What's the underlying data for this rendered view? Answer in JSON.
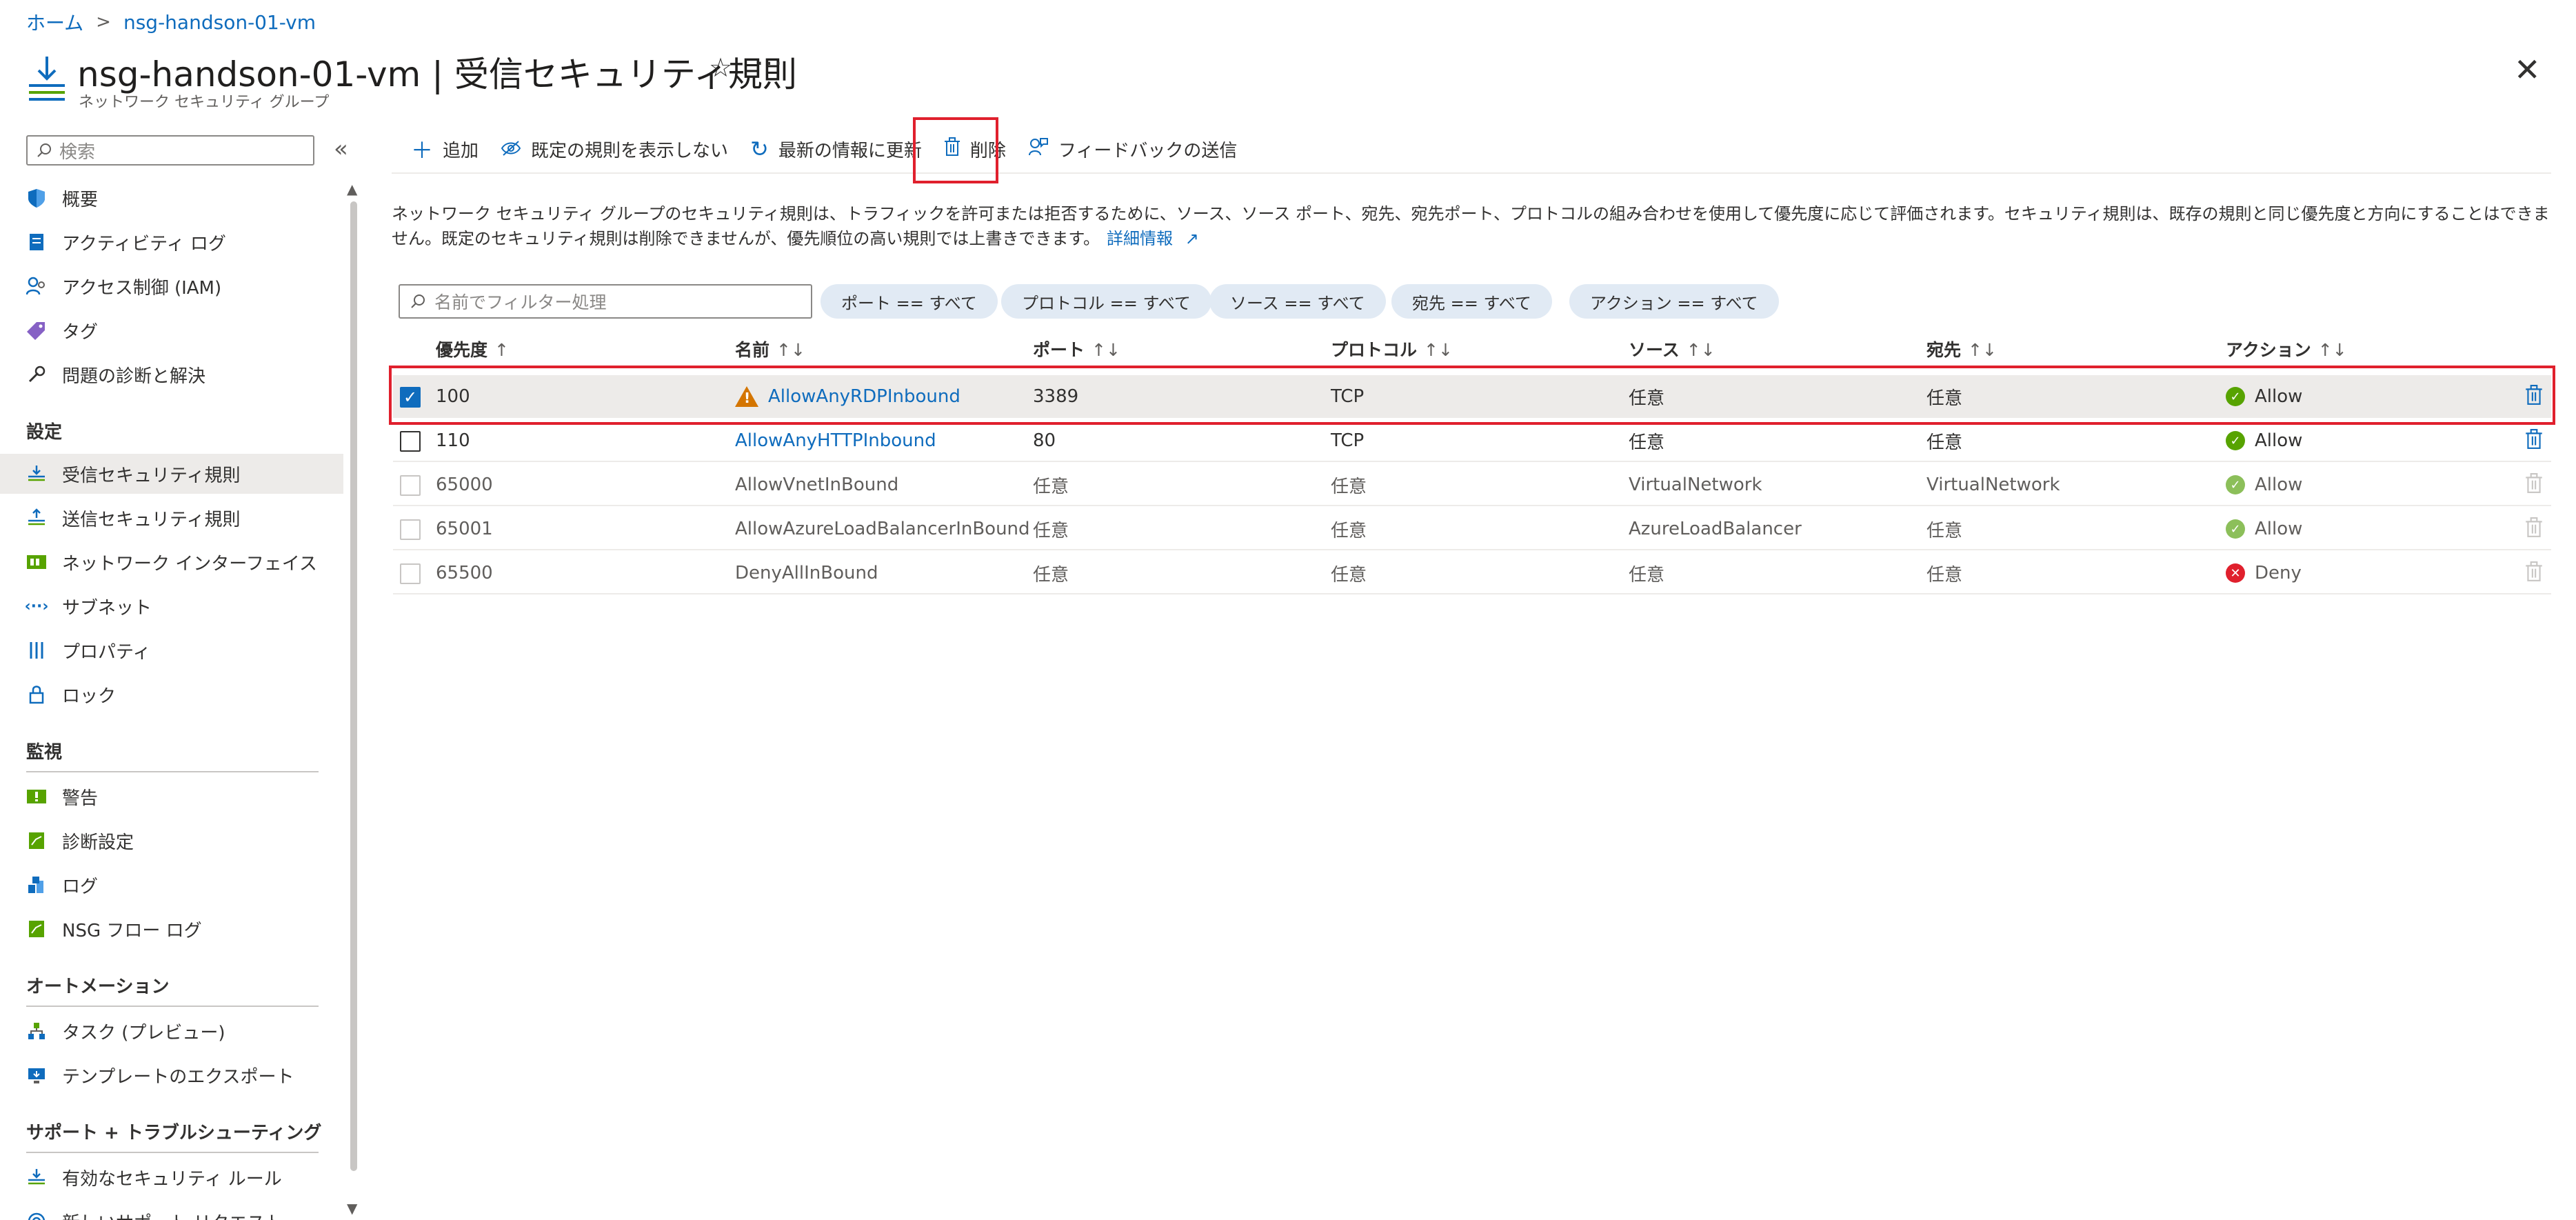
{
  "breadcrumb": {
    "home": "ホーム",
    "sep": ">",
    "current": "nsg-handson-01-vm"
  },
  "header": {
    "title": "nsg-handson-01-vm | 受信セキュリティ規則",
    "subtitle": "ネットワーク セキュリティ グループ",
    "star_icon": "☆",
    "more_icon": "···",
    "close_icon": "✕"
  },
  "sidebar": {
    "search_placeholder": "検索",
    "collapse_icon": "«",
    "items": [
      {
        "label": "概要",
        "icon": "shield-icon"
      },
      {
        "label": "アクティビティ ログ",
        "icon": "activity-log-icon"
      },
      {
        "label": "アクセス制御 (IAM)",
        "icon": "iam-icon"
      },
      {
        "label": "タグ",
        "icon": "tag-icon"
      },
      {
        "label": "問題の診断と解決",
        "icon": "wrench-icon"
      }
    ],
    "sections": [
      {
        "header": "設定",
        "items": [
          {
            "label": "受信セキュリティ規則",
            "icon": "inbound-rules-icon",
            "active": true
          },
          {
            "label": "送信セキュリティ規則",
            "icon": "outbound-rules-icon"
          },
          {
            "label": "ネットワーク インターフェイス",
            "icon": "nic-icon"
          },
          {
            "label": "サブネット",
            "icon": "subnet-icon"
          },
          {
            "label": "プロパティ",
            "icon": "properties-icon"
          },
          {
            "label": "ロック",
            "icon": "lock-icon"
          }
        ]
      },
      {
        "header": "監視",
        "items": [
          {
            "label": "警告",
            "icon": "alert-icon"
          },
          {
            "label": "診断設定",
            "icon": "diagnostic-settings-icon"
          },
          {
            "label": "ログ",
            "icon": "logs-icon"
          },
          {
            "label": "NSG フロー ログ",
            "icon": "flow-log-icon"
          }
        ]
      },
      {
        "header": "オートメーション",
        "items": [
          {
            "label": "タスク (プレビュー)",
            "icon": "tasks-icon"
          },
          {
            "label": "テンプレートのエクスポート",
            "icon": "export-template-icon"
          }
        ]
      },
      {
        "header": "サポート + トラブルシューティング",
        "items": [
          {
            "label": "有効なセキュリティ ルール",
            "icon": "effective-rules-icon"
          },
          {
            "label": "新しいサポート リクエスト",
            "icon": "support-icon"
          }
        ]
      }
    ]
  },
  "toolbar": {
    "add": "追加",
    "hide_default": "既定の規則を表示しない",
    "refresh": "最新の情報に更新",
    "delete": "削除",
    "feedback": "フィードバックの送信"
  },
  "description": {
    "text": "ネットワーク セキュリティ グループのセキュリティ規則は、トラフィックを許可または拒否するために、ソース、ソース ポート、宛先、宛先ポート、プロトコルの組み合わせを使用して優先度に応じて評価されます。セキュリティ規則は、既存の規則と同じ優先度と方向にすることはできません。既定のセキュリティ規則は削除できませんが、優先順位の高い規則では上書きできます。",
    "link": "詳細情報"
  },
  "filters": {
    "name_placeholder": "名前でフィルター処理",
    "pills": [
      "ポート == すべて",
      "プロトコル == すべて",
      "ソース == すべて",
      "宛先 == すべて",
      "アクション == すべて"
    ]
  },
  "table": {
    "columns": [
      "優先度",
      "名前",
      "ポート",
      "プロトコル",
      "ソース",
      "宛先",
      "アクション"
    ],
    "sort_icon": "↑↓",
    "sort_asc_icon": "↑",
    "rows": [
      {
        "priority": "100",
        "name": "AllowAnyRDPInbound",
        "port": "3389",
        "protocol": "TCP",
        "source": "任意",
        "destination": "任意",
        "action": "Allow",
        "selected": true,
        "warning": true,
        "custom": true
      },
      {
        "priority": "110",
        "name": "AllowAnyHTTPInbound",
        "port": "80",
        "protocol": "TCP",
        "source": "任意",
        "destination": "任意",
        "action": "Allow",
        "selected": false,
        "warning": false,
        "custom": true
      },
      {
        "priority": "65000",
        "name": "AllowVnetInBound",
        "port": "任意",
        "protocol": "任意",
        "source": "VirtualNetwork",
        "destination": "VirtualNetwork",
        "action": "Allow",
        "selected": false,
        "warning": false,
        "custom": false
      },
      {
        "priority": "65001",
        "name": "AllowAzureLoadBalancerInBound",
        "port": "任意",
        "protocol": "任意",
        "source": "AzureLoadBalancer",
        "destination": "任意",
        "action": "Allow",
        "selected": false,
        "warning": false,
        "custom": false
      },
      {
        "priority": "65500",
        "name": "DenyAllInBound",
        "port": "任意",
        "protocol": "任意",
        "source": "任意",
        "destination": "任意",
        "action": "Deny",
        "selected": false,
        "warning": false,
        "custom": false
      }
    ]
  },
  "colors": {
    "accent": "#0f6cbd",
    "allow": "#57a300",
    "deny": "#e0202d",
    "warning": "#d47500",
    "highlight": "#e0202d"
  }
}
